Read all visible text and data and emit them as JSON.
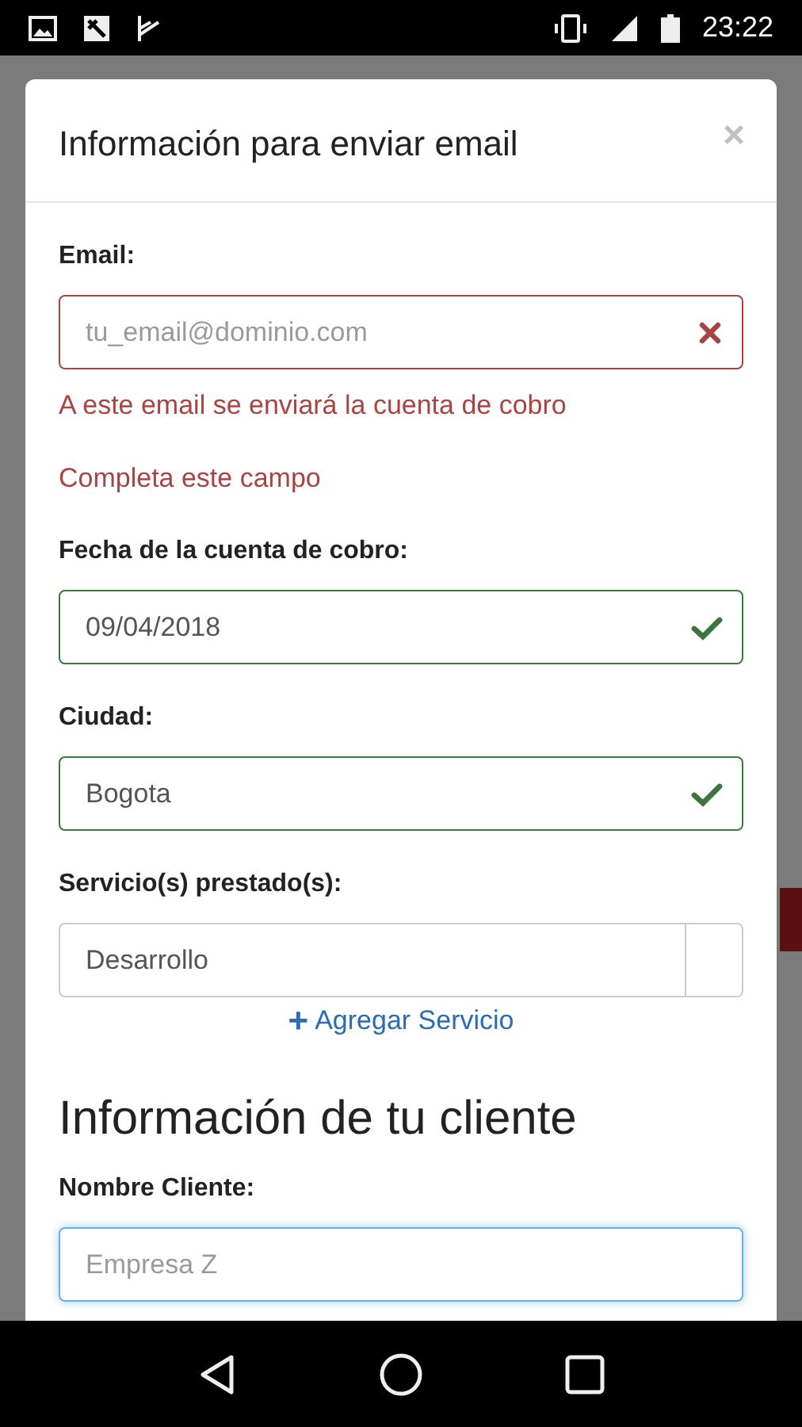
{
  "status_bar": {
    "time": "23:22"
  },
  "modal": {
    "title": "Información para enviar email",
    "close": "×",
    "fields": [
      {
        "label": "Email:",
        "placeholder": "tu_email@dominio.com",
        "error": true,
        "valid": false,
        "messages": [
          "A este email se enviará la cuenta de cobro",
          "Completa este campo"
        ]
      },
      {
        "label": "Fecha de la cuenta de cobro:",
        "value": "09/04/2018",
        "error": false,
        "valid": true
      },
      {
        "label": "Ciudad:",
        "value": "Bogota",
        "error": false,
        "valid": true
      },
      {
        "label": "Servicio(s) prestado(s):",
        "value": "Desarrollo",
        "error": false,
        "valid": false,
        "addon": true
      }
    ],
    "add_link": {
      "icon": "+",
      "label": "Agregar Servicio"
    },
    "section_heading": "Información de tu cliente",
    "client_fields": [
      {
        "label": "Nombre Cliente:",
        "placeholder": "Empresa Z",
        "error": false,
        "valid": false,
        "focused": true
      }
    ]
  }
}
